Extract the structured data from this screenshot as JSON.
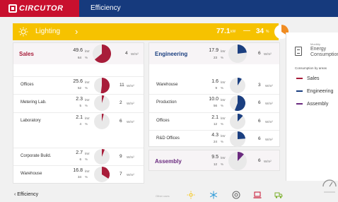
{
  "header": {
    "brand": "CIRCUTOR",
    "title": "Efficiency"
  },
  "lighting": {
    "label": "Lighting",
    "power": "77.1",
    "power_unit": "kW",
    "percent": "34",
    "percent_unit": "%",
    "dash": "—",
    "share": 0.34,
    "chevron": "›"
  },
  "kw_unit": "kW",
  "pct_unit": "%",
  "wm2_unit": "W/m²",
  "sales": {
    "name": "Sales",
    "kw": "49.6",
    "pct": "64",
    "wm2": "4",
    "share": 0.64,
    "color": "#a81d3a",
    "rows": [
      {
        "name": "Offices",
        "kw": "25.6",
        "pct": "52",
        "wm2": "11",
        "share": 0.52
      },
      {
        "name": "Metering Lab.",
        "kw": "2.3",
        "pct": "5",
        "wm2": "2",
        "share": 0.05
      },
      {
        "name": "Laboratory",
        "kw": "2.1",
        "pct": "4",
        "wm2": "6",
        "share": 0.04
      },
      {
        "name": "Corporate Build.",
        "kw": "2.7",
        "pct": "6",
        "wm2": "9",
        "share": 0.06
      },
      {
        "name": "Warehouse",
        "kw": "16.8",
        "pct": "34",
        "wm2": "7",
        "share": 0.34
      }
    ]
  },
  "engineering": {
    "name": "Engineering",
    "kw": "17.9",
    "pct": "23",
    "wm2": "6",
    "share": 0.23,
    "color": "#1b3f80",
    "rows": [
      {
        "name": "Warehouse",
        "kw": "1.6",
        "pct": "9",
        "wm2": "3",
        "share": 0.09
      },
      {
        "name": "Production",
        "kw": "10.0",
        "pct": "56",
        "wm2": "6",
        "share": 0.56
      },
      {
        "name": "Offices",
        "kw": "2.1",
        "pct": "12",
        "wm2": "6",
        "share": 0.12
      },
      {
        "name": "R&D Offices",
        "kw": "4.3",
        "pct": "24",
        "wm2": "6",
        "share": 0.24
      }
    ]
  },
  "assembly": {
    "name": "Assembly",
    "kw": "9.5",
    "pct": "12",
    "wm2": "6",
    "share": 0.12,
    "color": "#6a2a7f"
  },
  "right_panel": {
    "small": "Monthly",
    "title": "Energy Consumption",
    "consumption_label": "Consumption by areas",
    "legend": [
      {
        "label": "Sales",
        "color": "#a81d3a"
      },
      {
        "label": "Engineering",
        "color": "#1b3f80"
      },
      {
        "label": "Assembly",
        "color": "#6a2a7f"
      }
    ]
  },
  "footer": {
    "back": "‹ Efficiency",
    "other_uses": "Other uses"
  }
}
